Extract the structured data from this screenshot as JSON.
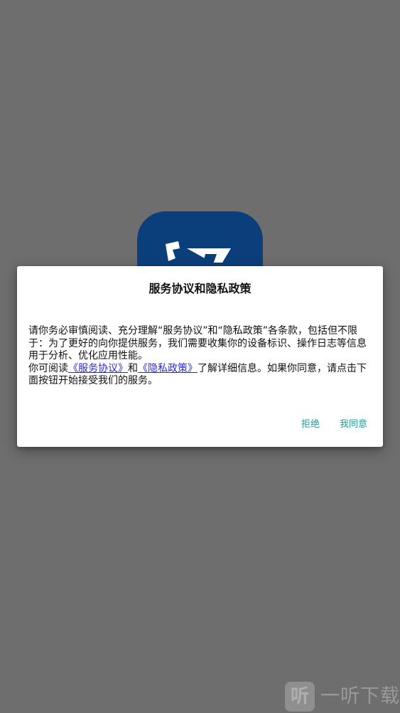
{
  "dialog": {
    "title": "服务协议和隐私政策",
    "paragraph1": "请你务必审慎阅读、充分理解“服务协议”和“隐私政策”各条款，包括但不限于：为了更好的向你提供服务，我们需要收集你的设备标识、操作日志等信息用于分析、优化应用性能。",
    "paragraph2_prefix": "你可阅读",
    "service_link": "《服务协议》",
    "and_text": "和",
    "privacy_link": "《隐私政策》",
    "paragraph2_suffix": "了解详细信息。如果你同意，请点击下面按钮开始接受我们的服务。",
    "reject_label": "拒绝",
    "agree_label": "我同意"
  },
  "watermark": {
    "mark": "听",
    "text": "一听下载"
  },
  "colors": {
    "backdrop": "#6e6e6e",
    "app_icon": "#0b3f7c",
    "accent": "#1e9b95",
    "link": "#2a2ad8"
  },
  "icons": {
    "app": "app-logo-icon"
  }
}
